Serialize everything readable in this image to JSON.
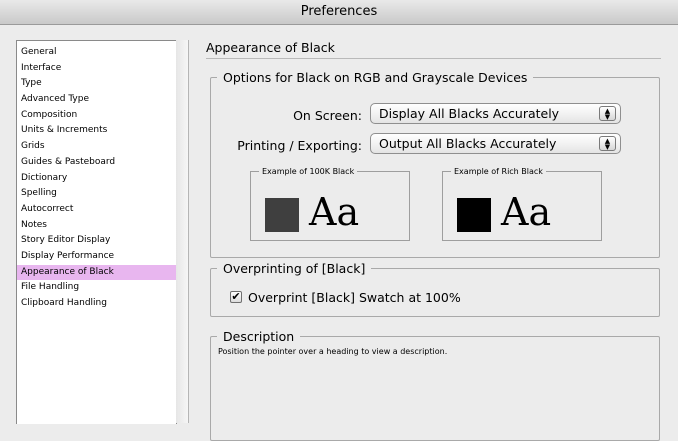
{
  "window": {
    "title": "Preferences"
  },
  "sidebar": {
    "items": [
      {
        "label": "General"
      },
      {
        "label": "Interface"
      },
      {
        "label": "Type"
      },
      {
        "label": "Advanced Type"
      },
      {
        "label": "Composition"
      },
      {
        "label": "Units & Increments"
      },
      {
        "label": "Grids"
      },
      {
        "label": "Guides & Pasteboard"
      },
      {
        "label": "Dictionary"
      },
      {
        "label": "Spelling"
      },
      {
        "label": "Autocorrect"
      },
      {
        "label": "Notes"
      },
      {
        "label": "Story Editor Display"
      },
      {
        "label": "Display Performance"
      },
      {
        "label": "Appearance of Black",
        "selected": true
      },
      {
        "label": "File Handling"
      },
      {
        "label": "Clipboard Handling"
      }
    ]
  },
  "main": {
    "title": "Appearance of Black",
    "options_group": {
      "legend": "Options for Black on RGB and Grayscale Devices",
      "on_screen_label": "On Screen:",
      "on_screen_value": "Display All Blacks Accurately",
      "printing_label": "Printing / Exporting:",
      "printing_value": "Output All Blacks Accurately",
      "example_100k": {
        "legend": "Example of 100K Black",
        "sample_text": "Aa",
        "swatch_color": "#3f3f3f"
      },
      "example_rich": {
        "legend": "Example of Rich Black",
        "sample_text": "Aa",
        "swatch_color": "#000000"
      }
    },
    "overprint_group": {
      "legend": "Overprinting of [Black]",
      "checkbox_label": "Overprint [Black] Swatch at 100%",
      "checked": true
    },
    "description_group": {
      "legend": "Description",
      "text": "Position the pointer over a heading to view a description."
    }
  },
  "colors": {
    "selection": "#e8b6ef"
  }
}
